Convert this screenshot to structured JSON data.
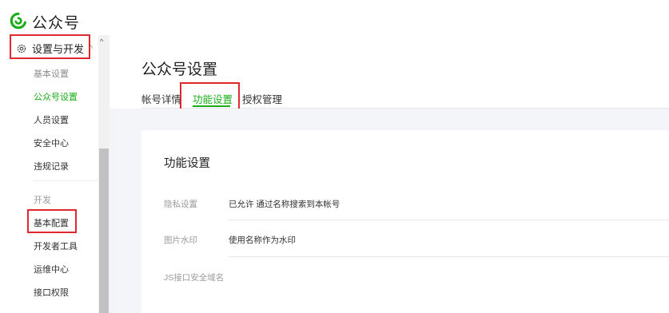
{
  "brand": {
    "name": "公众号",
    "logo_icon": "wechat-oa-logo-icon",
    "color": "#1aad19"
  },
  "sidebar": {
    "section": {
      "label": "设置与开发",
      "icon": "gear-icon",
      "caret": "^"
    },
    "items": [
      {
        "label": "基本设置",
        "state": "muted"
      },
      {
        "label": "公众号设置",
        "state": "active"
      },
      {
        "label": "人员设置",
        "state": "normal"
      },
      {
        "label": "安全中心",
        "state": "normal"
      },
      {
        "label": "违规记录",
        "state": "normal"
      }
    ],
    "dev_section": {
      "label": "开发"
    },
    "dev_items": [
      {
        "label": "基本配置"
      },
      {
        "label": "开发者工具"
      },
      {
        "label": "运维中心"
      },
      {
        "label": "接口权限"
      }
    ],
    "scroll_up": "^"
  },
  "page": {
    "title": "公众号设置",
    "tabs": [
      {
        "label": "帐号详情"
      },
      {
        "label": "功能设置",
        "active": true
      },
      {
        "label": "授权管理"
      }
    ]
  },
  "card": {
    "title": "功能设置",
    "rows": [
      {
        "label": "隐私设置",
        "value": "已允许 通过名称搜索到本帐号"
      },
      {
        "label": "图片水印",
        "value": "使用名称作为水印"
      },
      {
        "label": "JS接口安全域名",
        "value": ""
      }
    ]
  },
  "accent_color": "#1aad19",
  "highlight_color": "#e0282e"
}
